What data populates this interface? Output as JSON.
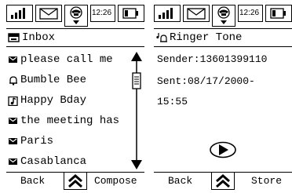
{
  "status": {
    "time": "12:26"
  },
  "left_screen": {
    "title": "Inbox",
    "title_icon": "inbox-tray-icon",
    "messages": [
      {
        "icon": "envelope-icon",
        "text": "please call me"
      },
      {
        "icon": "bell-icon",
        "text": "Bumble Bee"
      },
      {
        "icon": "note-icon",
        "text": "Happy Bday"
      },
      {
        "icon": "envelope-icon",
        "text": "the meeting has"
      },
      {
        "icon": "envelope-icon",
        "text": "Paris"
      },
      {
        "icon": "envelope-icon",
        "text": "Casablanca"
      }
    ],
    "softkeys": {
      "left": "Back",
      "right": "Compose"
    }
  },
  "right_screen": {
    "title": "Ringer Tone",
    "title_icon": "ringer-note-icon",
    "sender_line": "Sender:13601399110",
    "sent_line": "Sent:08/17/2000-",
    "sent_time": "15:55",
    "play_icon": "play-icon",
    "softkeys": {
      "left": "Back",
      "right": "Store"
    }
  }
}
